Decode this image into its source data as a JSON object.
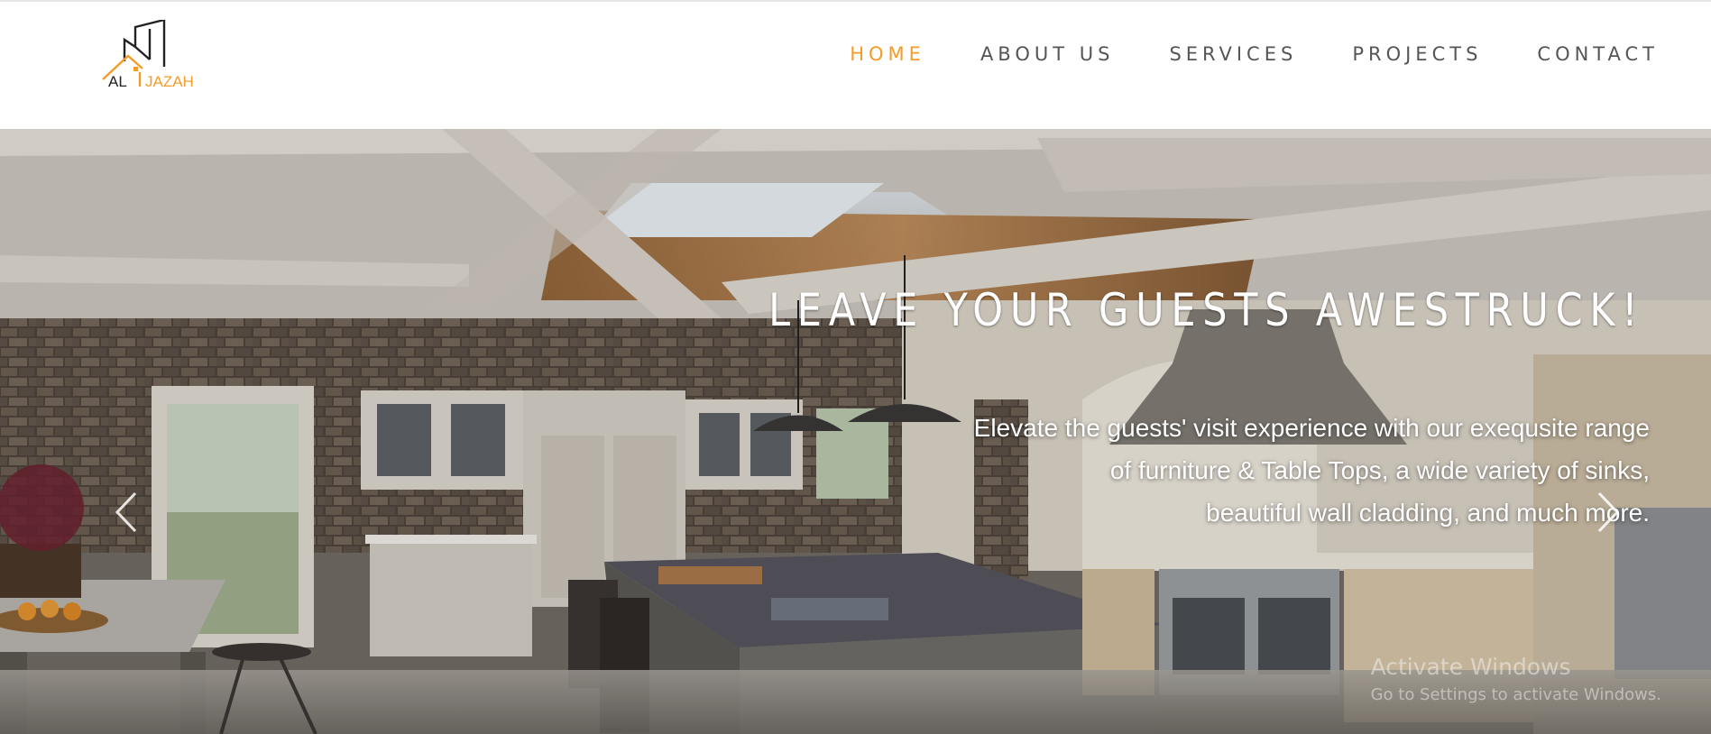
{
  "logo": {
    "text_left": "AL",
    "text_right": "JAZAH",
    "accent_color": "#f39c2a",
    "dark_color": "#222222"
  },
  "nav": {
    "items": [
      {
        "label": "HOME",
        "active": true
      },
      {
        "label": "ABOUT US",
        "active": false
      },
      {
        "label": "SERVICES",
        "active": false
      },
      {
        "label": "PROJECTS",
        "active": false
      },
      {
        "label": "CONTACT",
        "active": false
      }
    ]
  },
  "hero": {
    "title": "LEAVE YOUR GUESTS AWESTRUCK!",
    "subtitle_lines": [
      "Elevate the guests' visit experience with our exequsite range",
      "of furniture & Table Tops, a wide variety of sinks,",
      "beautiful wall cladding, and much more."
    ],
    "prev_icon": "chevron-left-icon",
    "next_icon": "chevron-right-icon"
  },
  "watermark": {
    "line1": "Activate Windows",
    "line2": "Go to Settings to activate Windows."
  }
}
